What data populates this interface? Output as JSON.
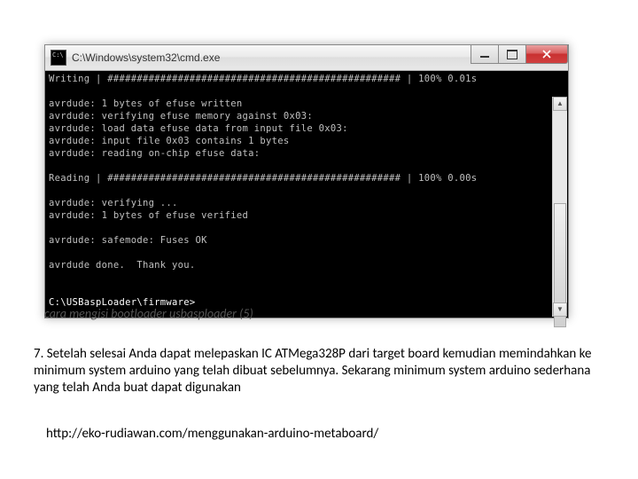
{
  "window": {
    "title": "C:\\Windows\\system32\\cmd.exe"
  },
  "term": {
    "l0": "Writing | ################################################## | 100% 0.01s",
    "l1": "",
    "l2": "avrdude: 1 bytes of efuse written",
    "l3": "avrdude: verifying efuse memory against 0x03:",
    "l4": "avrdude: load data efuse data from input file 0x03:",
    "l5": "avrdude: input file 0x03 contains 1 bytes",
    "l6": "avrdude: reading on-chip efuse data:",
    "l7": "",
    "l8": "Reading | ################################################## | 100% 0.00s",
    "l9": "",
    "l10": "avrdude: verifying ...",
    "l11": "avrdude: 1 bytes of efuse verified",
    "l12": "",
    "l13": "avrdude: safemode: Fuses OK",
    "l14": "",
    "l15": "avrdude done.  Thank you.",
    "l16": "",
    "l17": "",
    "prompt": "C:\\USBaspLoader\\firmware>"
  },
  "caption": "cara mengisi bootloader usbasploader (5)",
  "body": "7. Setelah selesai Anda dapat melepaskan IC ATMega328P dari target board kemudian memindahkan ke minimum system arduino yang telah dibuat sebelumnya. Sekarang minimum system arduino sederhana yang telah Anda buat dapat digunakan",
  "link": "http://eko-rudiawan.com/menggunakan-arduino-metaboard/"
}
